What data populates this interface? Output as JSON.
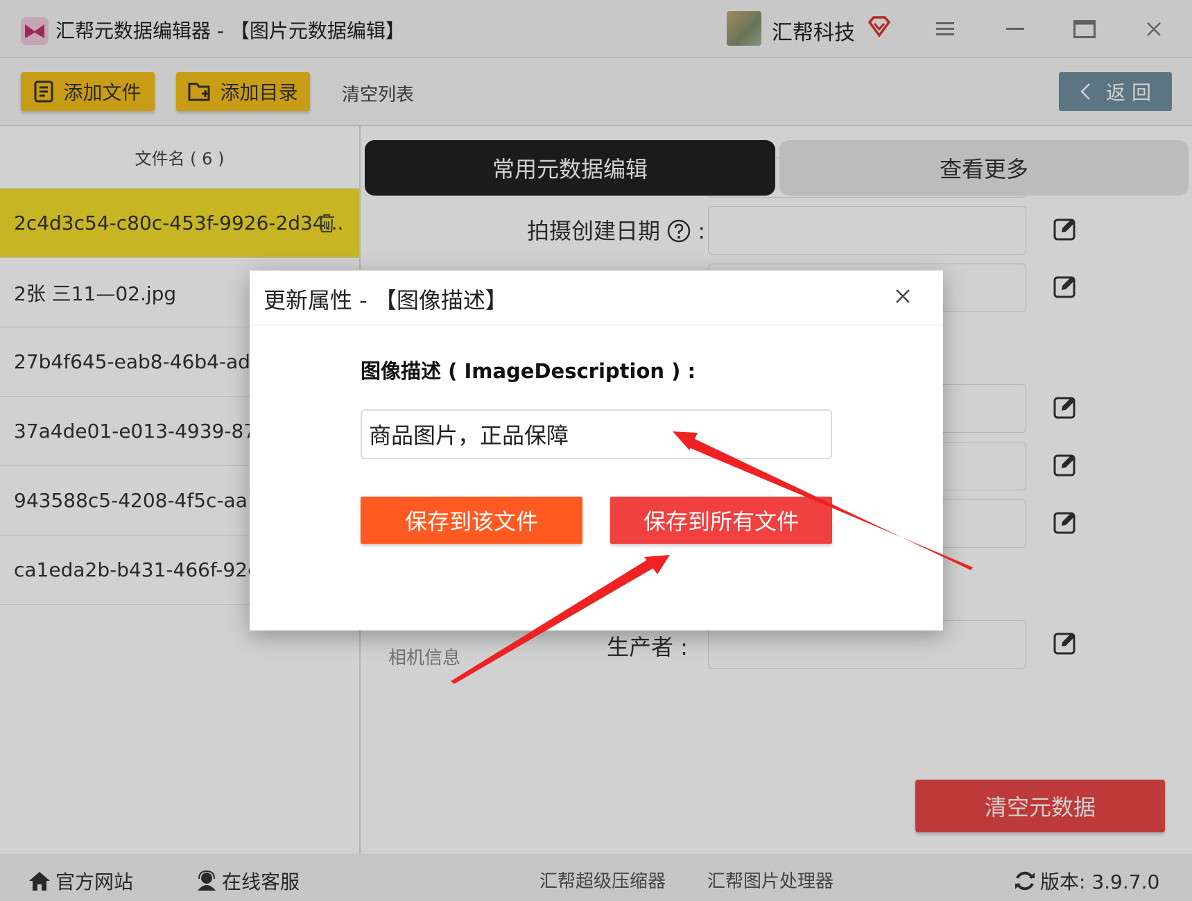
{
  "window": {
    "title": "汇帮元数据编辑器 - 【图片元数据编辑】",
    "company": "汇帮科技"
  },
  "toolbar": {
    "add_file": "添加文件",
    "add_dir": "添加目录",
    "clear_list": "清空列表",
    "back": "返 回"
  },
  "sidebar": {
    "header": "文件名 ( 6 )",
    "files": [
      "2c4d3c54-c80c-453f-9926-2d34...",
      "2张 三11—02.jpg",
      "27b4f645-eab8-46b4-ad7",
      "37a4de01-e013-4939-87a",
      "943588c5-4208-4f5c-aa1a",
      "ca1eda2b-b431-466f-92c"
    ]
  },
  "main": {
    "tabs": [
      "常用元数据编辑",
      "查看更多"
    ],
    "fields": {
      "capture_date": "拍摄创建日期",
      "capture_date_suffix": ":",
      "producer": "生产者 :"
    },
    "section_camera": "相机信息",
    "clear_metadata": "清空元数据"
  },
  "footer": {
    "website": "官方网站",
    "support": "在线客服",
    "compressor": "汇帮超级压缩器",
    "image_tool": "汇帮图片处理器",
    "version": "版本: 3.9.7.0"
  },
  "dialog": {
    "title": "更新属性 - 【图像描述】",
    "label": "图像描述 ( ImageDescription ) :",
    "value": "商品图片，正品保障",
    "save_this": "保存到该文件",
    "save_all": "保存到所有文件"
  },
  "colors": {
    "accent_yellow": "#f6bf1a",
    "active_tab": "#222222",
    "save_this": "#ff5a22",
    "save_all": "#f04040",
    "clear_btn": "#e84747",
    "arrow": "#ee2222"
  }
}
